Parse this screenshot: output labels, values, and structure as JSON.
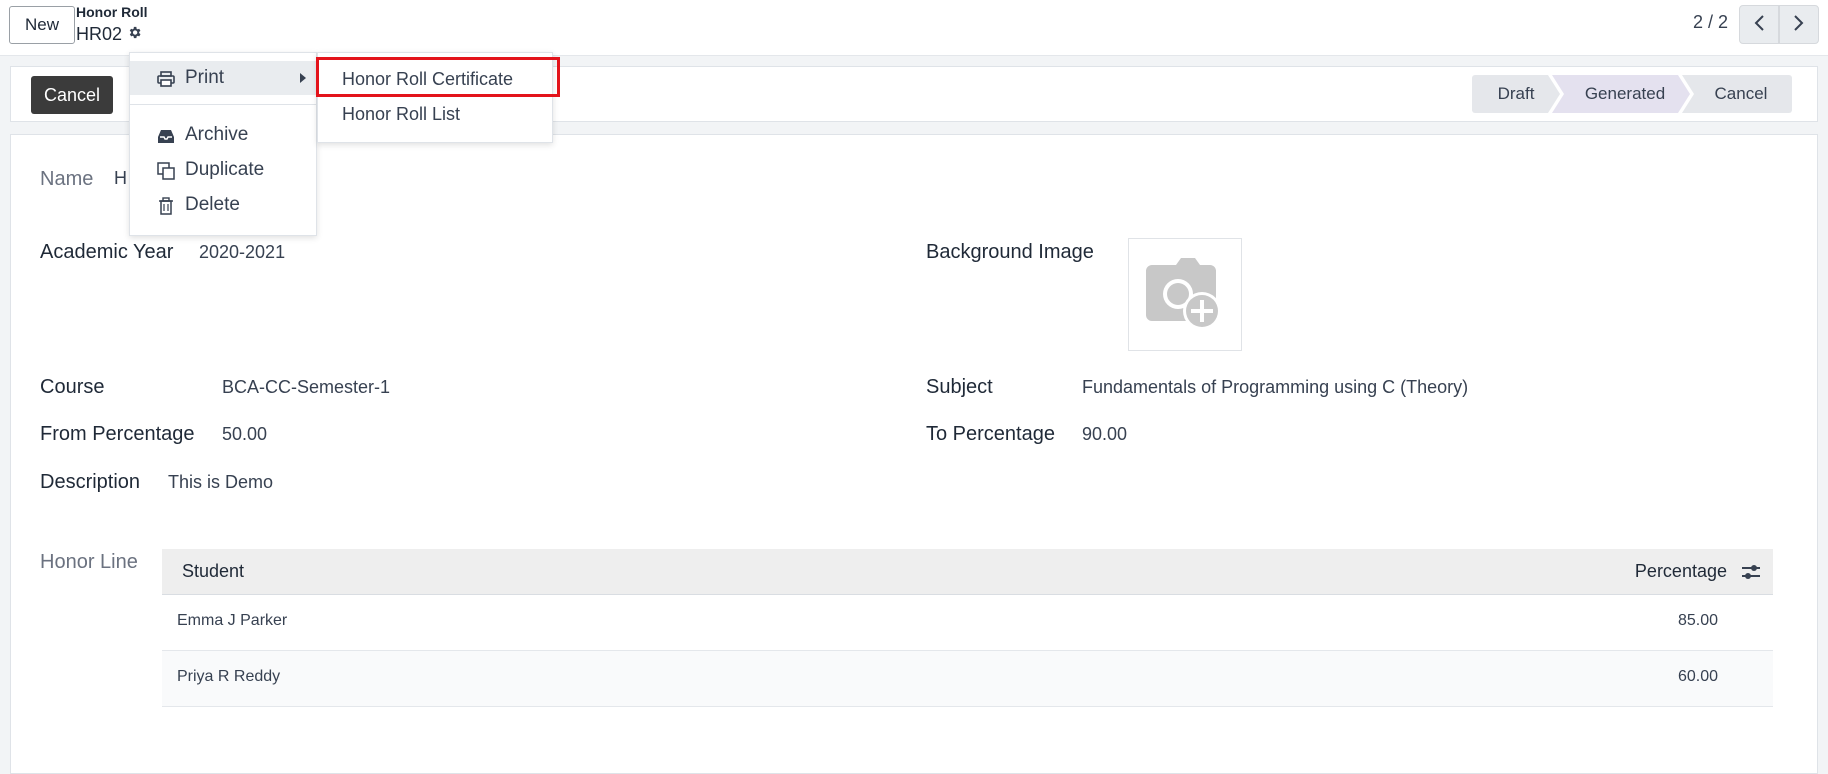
{
  "topbar": {
    "new_label": "New",
    "breadcrumb_parent": "Honor Roll",
    "record_name": "HR02",
    "pager": "2 / 2"
  },
  "statusbar": {
    "cancel_label": "Cancel",
    "stages": [
      "Draft",
      "Generated",
      "Cancel"
    ],
    "active_stage": "Generated"
  },
  "form": {
    "name_label": "Name",
    "name_value_partial": "H",
    "academic_year_label": "Academic Year",
    "academic_year_value": "2020-2021",
    "background_image_label": "Background Image",
    "course_label": "Course",
    "course_value": "BCA-CC-Semester-1",
    "subject_label": "Subject",
    "subject_value": "Fundamentals of Programming using C (Theory)",
    "from_pct_label": "From Percentage",
    "from_pct_value": "50.00",
    "to_pct_label": "To Percentage",
    "to_pct_value": "90.00",
    "description_label": "Description",
    "description_value": "This is Demo",
    "honor_line_label": "Honor Line"
  },
  "table": {
    "col_student": "Student",
    "col_percentage": "Percentage",
    "rows": [
      {
        "student": "Emma J Parker",
        "percentage": "85.00"
      },
      {
        "student": "Priya R Reddy",
        "percentage": "60.00"
      }
    ]
  },
  "gear_menu": {
    "print": "Print",
    "archive": "Archive",
    "duplicate": "Duplicate",
    "delete": "Delete"
  },
  "print_submenu": {
    "items": [
      "Honor Roll Certificate",
      "Honor Roll List"
    ],
    "highlighted": "Honor Roll Certificate"
  },
  "colors": {
    "highlight_border": "#e3131b",
    "cancel_button_bg": "#3b3b3b",
    "active_stage_bg": "#e4e1ef"
  }
}
